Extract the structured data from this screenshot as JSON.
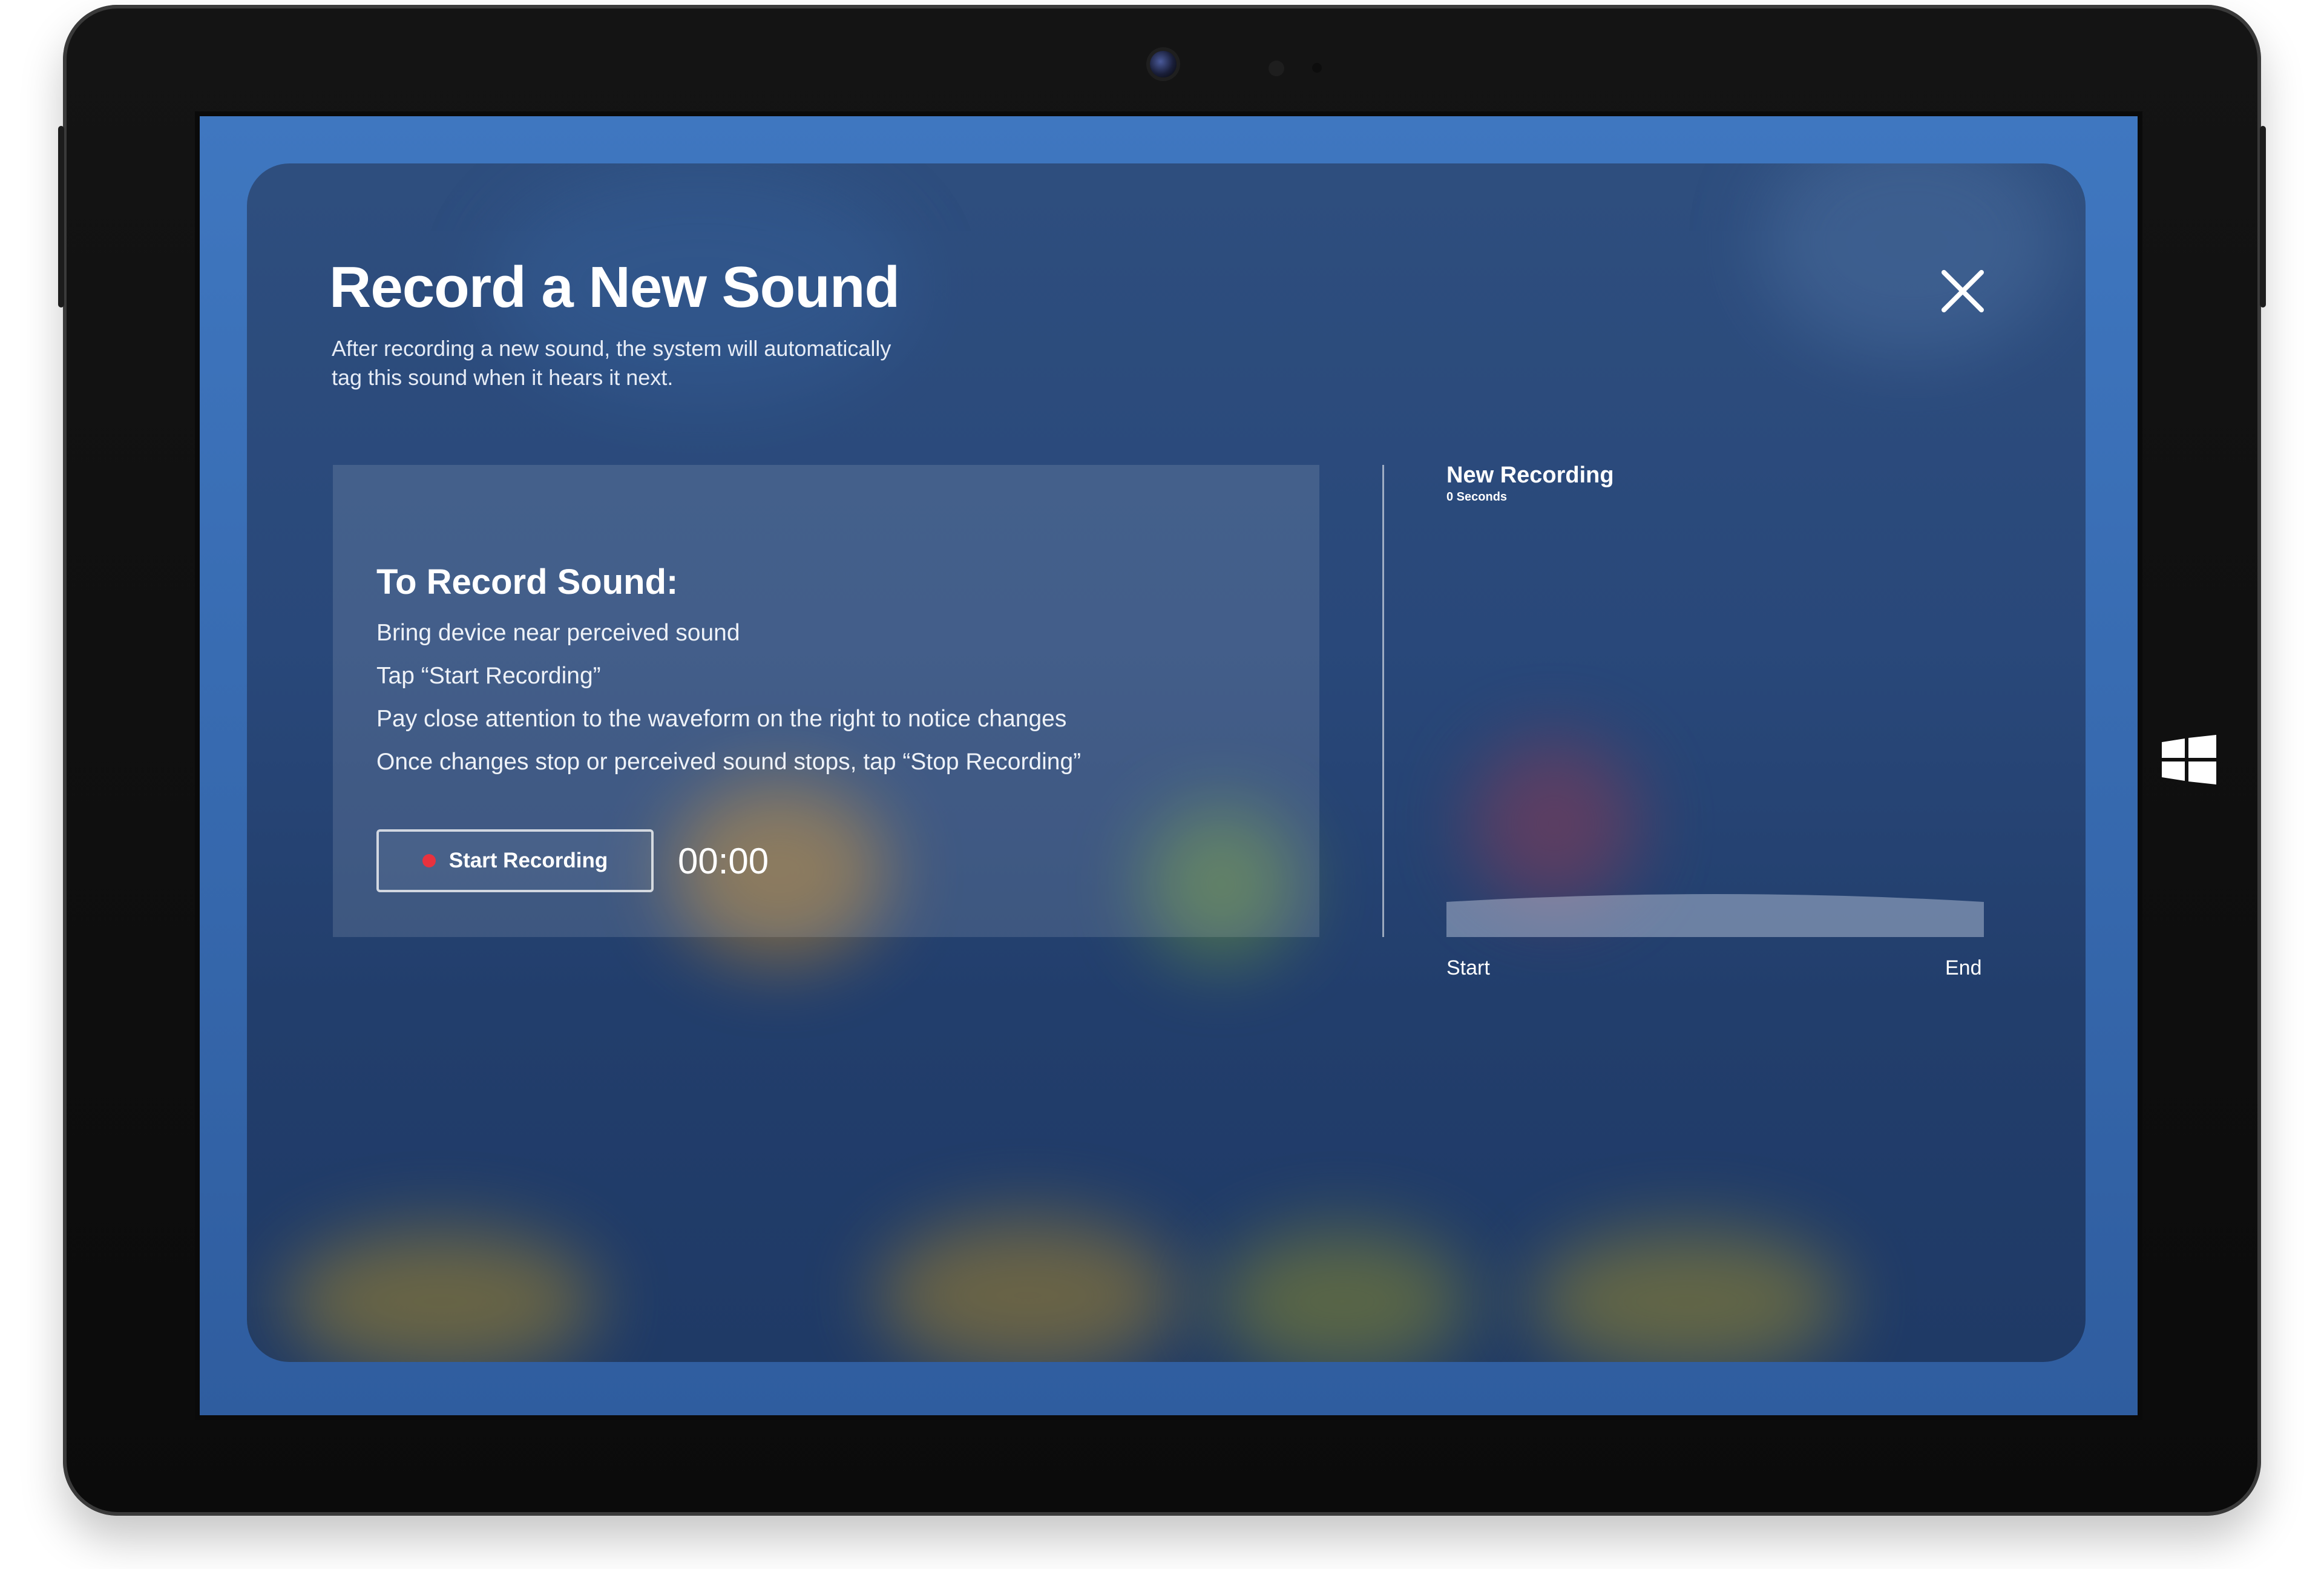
{
  "dialog": {
    "title": "Record a New Sound",
    "subtitle_line1": "After recording a new sound, the system will automatically",
    "subtitle_line2": "tag this sound when it hears it next."
  },
  "instructions": {
    "heading": "To Record Sound:",
    "steps": [
      "Bring device near perceived sound",
      "Tap “Start Recording”",
      "Pay close attention to the waveform on the right to notice changes",
      "Once changes stop or perceived sound stops, tap “Stop Recording”"
    ]
  },
  "controls": {
    "record_button_label": "Start Recording",
    "timer": "00:00"
  },
  "recording": {
    "title": "New Recording",
    "duration": "0 Seconds",
    "start_label": "Start",
    "end_label": "End"
  },
  "icons": {
    "close": "close-icon",
    "record_dot": "record-dot-icon",
    "windows": "windows-logo-icon"
  },
  "colors": {
    "record_dot": "#e8323e",
    "screen_blue": "#3f77c0",
    "panel_blue": "#29487a"
  }
}
